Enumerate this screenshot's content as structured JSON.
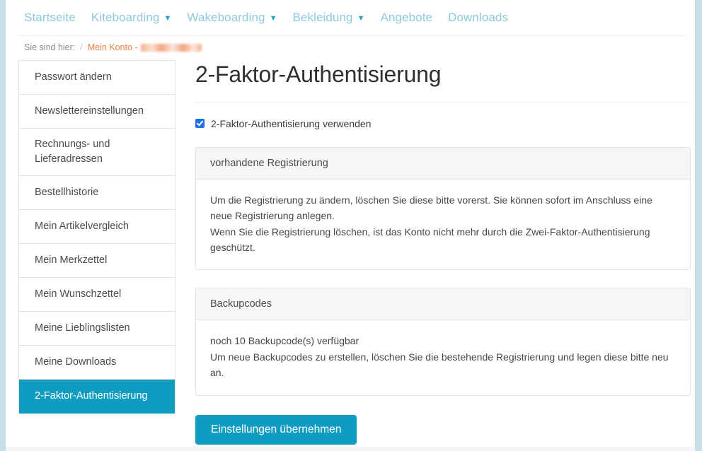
{
  "nav": {
    "items": [
      {
        "label": "Startseite",
        "has_dropdown": false
      },
      {
        "label": "Kiteboarding",
        "has_dropdown": true
      },
      {
        "label": "Wakeboarding",
        "has_dropdown": true
      },
      {
        "label": "Bekleidung",
        "has_dropdown": true
      },
      {
        "label": "Angebote",
        "has_dropdown": false
      },
      {
        "label": "Downloads",
        "has_dropdown": false
      }
    ],
    "link_color": "#8dc9db",
    "caret_color": "#2b9fc4",
    "caret_glyph": "▼"
  },
  "breadcrumb": {
    "prefix": "Sie sind hier:",
    "separator": "/",
    "link": "Mein Konto -",
    "redacted_value": ""
  },
  "sidebar": {
    "items": [
      {
        "label": "Passwort ändern",
        "active": false
      },
      {
        "label": "Newslettereinstellungen",
        "active": false
      },
      {
        "label": "Rechnungs- und Lieferadressen",
        "active": false
      },
      {
        "label": "Bestellhistorie",
        "active": false
      },
      {
        "label": "Mein Artikelvergleich",
        "active": false
      },
      {
        "label": "Mein Merkzettel",
        "active": false
      },
      {
        "label": "Mein Wunschzettel",
        "active": false
      },
      {
        "label": "Meine Lieblingslisten",
        "active": false
      },
      {
        "label": "Meine Downloads",
        "active": false
      },
      {
        "label": "2-Faktor-Authentisierung",
        "active": true
      }
    ],
    "active_color": "#109cc0"
  },
  "main": {
    "title": "2-Faktor-Authentisierung",
    "enable_checkbox": {
      "label": "2-Faktor-Authentisierung verwenden",
      "checked": true,
      "color": "#1b72e8"
    },
    "panels": [
      {
        "heading": "vorhandene Registrierung",
        "lines": [
          "Um die Registrierung zu ändern, löschen Sie diese bitte vorerst. Sie können sofort im Anschluss eine neue Registrierung anlegen.",
          "Wenn Sie die Registrierung löschen, ist das Konto nicht mehr durch die Zwei-Faktor-Authentisierung geschützt."
        ]
      },
      {
        "heading": "Backupcodes",
        "lines": [
          "noch 10 Backupcode(s) verfügbar",
          "Um neue Backupcodes zu erstellen, löschen Sie die bestehende Registrierung und legen diese bitte neu an."
        ]
      }
    ],
    "submit_label": "Einstellungen übernehmen",
    "submit_color": "#109cc0"
  }
}
